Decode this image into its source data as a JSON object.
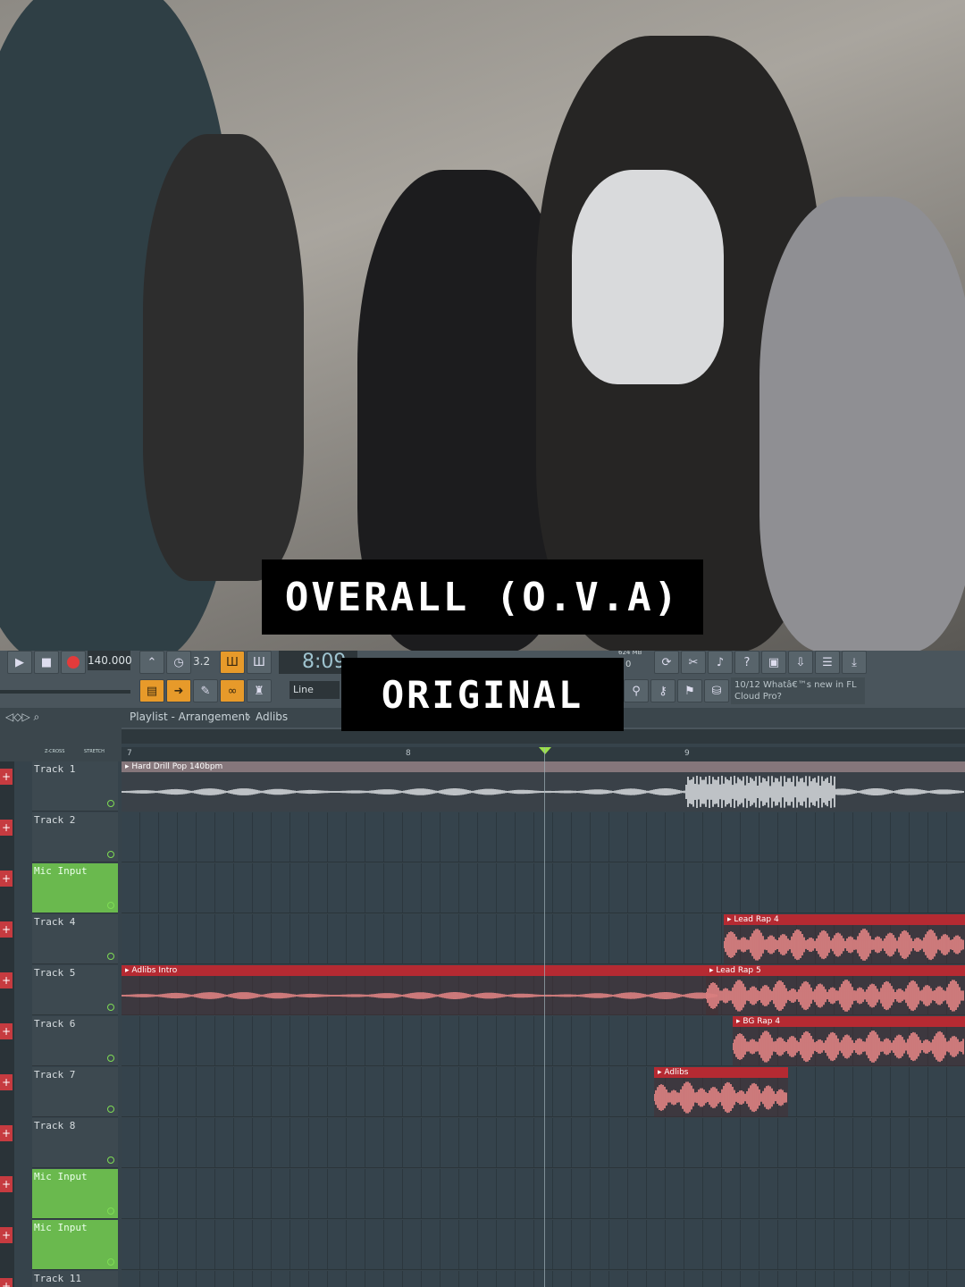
{
  "captions": {
    "top": "OVERALL (O.V.A)",
    "bottom": "ORIGINAL"
  },
  "toolbar": {
    "tempo": "140.000",
    "time": "8:09",
    "pattern": "3.2",
    "snap": "Line",
    "news": "10/12  Whatâ€™s new in FL Cloud Pro?",
    "mem": "624 MB",
    "zero": "0"
  },
  "breadcrumb": {
    "playlist": "Playlist - Arrangement",
    "sep": "›",
    "pattern": "Adlibs"
  },
  "ruler": {
    "marks": [
      "7",
      "8",
      "9"
    ],
    "xcross": "Z-CROSS",
    "stretch": "STRETCH"
  },
  "tracks": [
    {
      "label": "Track 1",
      "green": false
    },
    {
      "label": "Track 2",
      "green": false
    },
    {
      "label": "Mic Input",
      "green": true
    },
    {
      "label": "Track 4",
      "green": false
    },
    {
      "label": "Track 5",
      "green": false
    },
    {
      "label": "Track 6",
      "green": false
    },
    {
      "label": "Track 7",
      "green": false
    },
    {
      "label": "Track 8",
      "green": false
    },
    {
      "label": "Mic Input",
      "green": true
    },
    {
      "label": "Mic Input",
      "green": true
    },
    {
      "label": "Track 11",
      "green": false
    }
  ],
  "clips": [
    {
      "name": "Hard Drill Pop 140bpm",
      "track": 0,
      "style": "grey"
    },
    {
      "name": "Lead Rap 4",
      "track": 3,
      "style": "red"
    },
    {
      "name": "Adlibs Intro",
      "track": 4,
      "style": "red"
    },
    {
      "name": "Lead Rap 5",
      "track": 4,
      "style": "red"
    },
    {
      "name": "BG Rap 4",
      "track": 5,
      "style": "red"
    },
    {
      "name": "Adlibs",
      "track": 6,
      "style": "red"
    }
  ],
  "colors": {
    "accent": "#e79a2a",
    "clip_red": "#b52a32",
    "mic_green": "#6ab94e",
    "wave_pink": "#f08a8a"
  }
}
